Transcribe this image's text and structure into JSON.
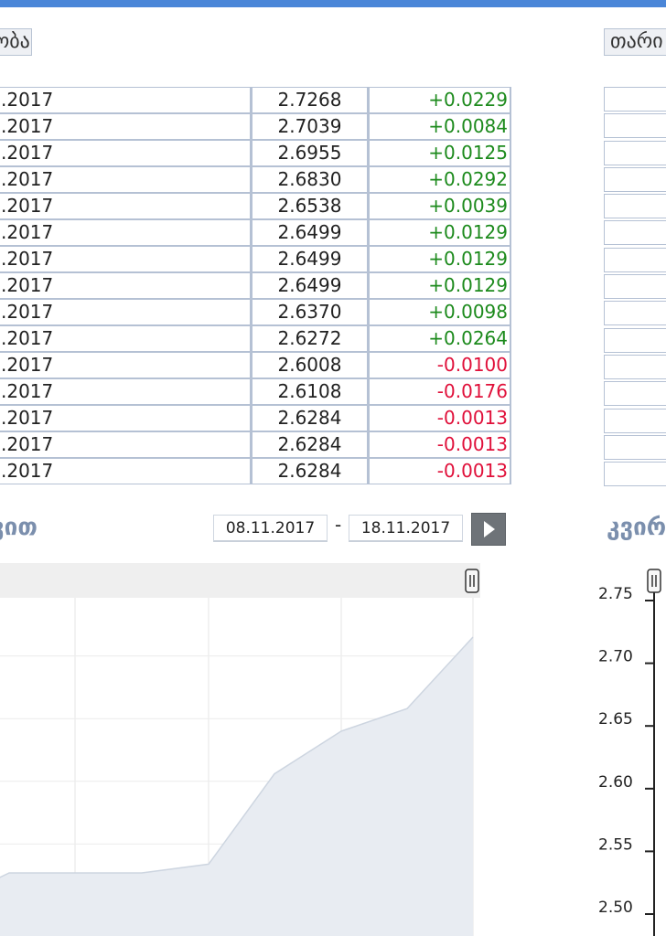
{
  "tabs": {
    "left": "ობა",
    "right": "თარი"
  },
  "rates_table": {
    "rows": [
      {
        "date": ".2017",
        "rate": "2.7268",
        "change": "+0.0229",
        "dir": "pos"
      },
      {
        "date": ".2017",
        "rate": "2.7039",
        "change": "+0.0084",
        "dir": "pos"
      },
      {
        "date": ".2017",
        "rate": "2.6955",
        "change": "+0.0125",
        "dir": "pos"
      },
      {
        "date": ".2017",
        "rate": "2.6830",
        "change": "+0.0292",
        "dir": "pos"
      },
      {
        "date": ".2017",
        "rate": "2.6538",
        "change": "+0.0039",
        "dir": "pos"
      },
      {
        "date": ".2017",
        "rate": "2.6499",
        "change": "+0.0129",
        "dir": "pos"
      },
      {
        "date": ".2017",
        "rate": "2.6499",
        "change": "+0.0129",
        "dir": "pos"
      },
      {
        "date": ".2017",
        "rate": "2.6499",
        "change": "+0.0129",
        "dir": "pos"
      },
      {
        "date": ".2017",
        "rate": "2.6370",
        "change": "+0.0098",
        "dir": "pos"
      },
      {
        "date": ".2017",
        "rate": "2.6272",
        "change": "+0.0264",
        "dir": "pos"
      },
      {
        "date": ".2017",
        "rate": "2.6008",
        "change": "-0.0100",
        "dir": "neg"
      },
      {
        "date": ".2017",
        "rate": "2.6108",
        "change": "-0.0176",
        "dir": "neg"
      },
      {
        "date": ".2017",
        "rate": "2.6284",
        "change": "-0.0013",
        "dir": "neg"
      },
      {
        "date": ".2017",
        "rate": "2.6284",
        "change": "-0.0013",
        "dir": "neg"
      },
      {
        "date": ".2017",
        "rate": "2.6284",
        "change": "-0.0013",
        "dir": "neg"
      }
    ]
  },
  "period": {
    "title": "ვით",
    "from": "08.11.2017",
    "separator": "-",
    "to": "18.11.2017",
    "go_icon": "play-icon"
  },
  "right_section": {
    "title": "კვირ"
  },
  "colors": {
    "positive": "#1c8a1c",
    "negative": "#e0103a",
    "accent": "#4a86d8"
  },
  "chart_data": {
    "type": "area",
    "y_ticks": [
      "2.75",
      "2.70",
      "2.65",
      "2.60",
      "2.55",
      "2.50"
    ],
    "series": [
      {
        "values": [
          2.52,
          2.527,
          2.527,
          2.527,
          2.527,
          2.534,
          2.606,
          2.64,
          2.658,
          2.715
        ]
      }
    ],
    "ylim": [
      2.5,
      2.75
    ],
    "grid": true
  }
}
